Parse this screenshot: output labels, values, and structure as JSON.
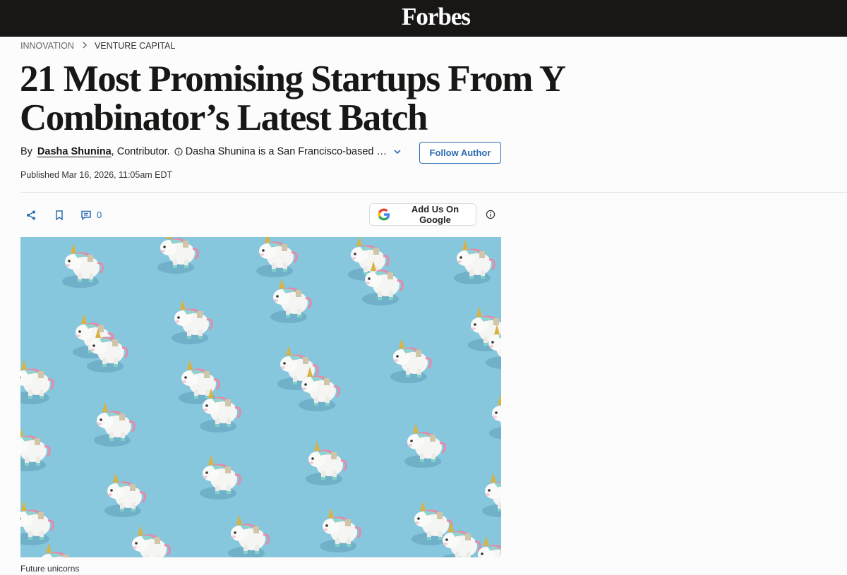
{
  "header": {
    "logo": "Forbes"
  },
  "breadcrumb": {
    "section": "INNOVATION",
    "subsection": "VENTURE CAPITAL"
  },
  "article": {
    "title": "21 Most Promising Startups From Y Combinator’s Latest Batch",
    "byline_prefix": "By",
    "author": "Dasha Shunina",
    "role": ", Contributor.",
    "bio": "Dasha Shunina is a San Francisco-based co…",
    "follow_label": "Follow Author",
    "published": "Published Mar 16, 2026, 11:05am EDT",
    "comment_count": "0",
    "google_label": "Add Us On Google",
    "image_caption": "Future unicorns"
  },
  "icons": {
    "share": "share-icon",
    "bookmark": "bookmark-icon",
    "comment": "comment-icon",
    "info": "info-icon",
    "google": "google-logo",
    "chevron": "chevron-down-icon"
  },
  "colors": {
    "topbar": "#181716",
    "link_blue": "#2b6cb0",
    "image_bg": "#86c7de"
  }
}
